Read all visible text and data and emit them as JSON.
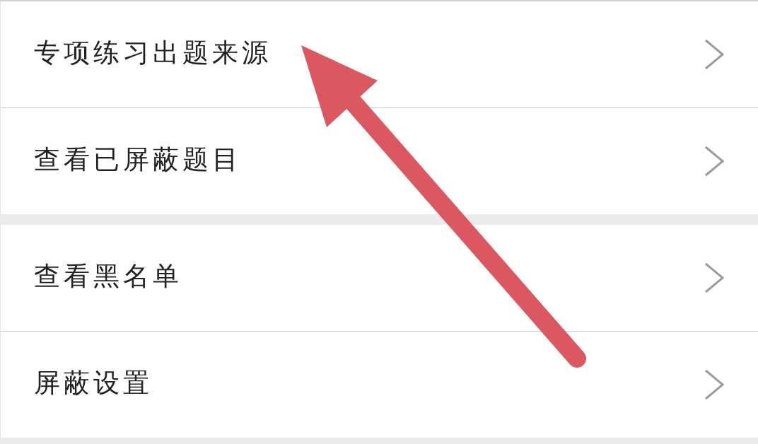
{
  "groups": [
    {
      "items": [
        {
          "label": "专项练习出题来源"
        },
        {
          "label": "查看已屏蔽题目"
        }
      ]
    },
    {
      "items": [
        {
          "label": "查看黑名单"
        },
        {
          "label": "屏蔽设置"
        }
      ]
    }
  ]
}
